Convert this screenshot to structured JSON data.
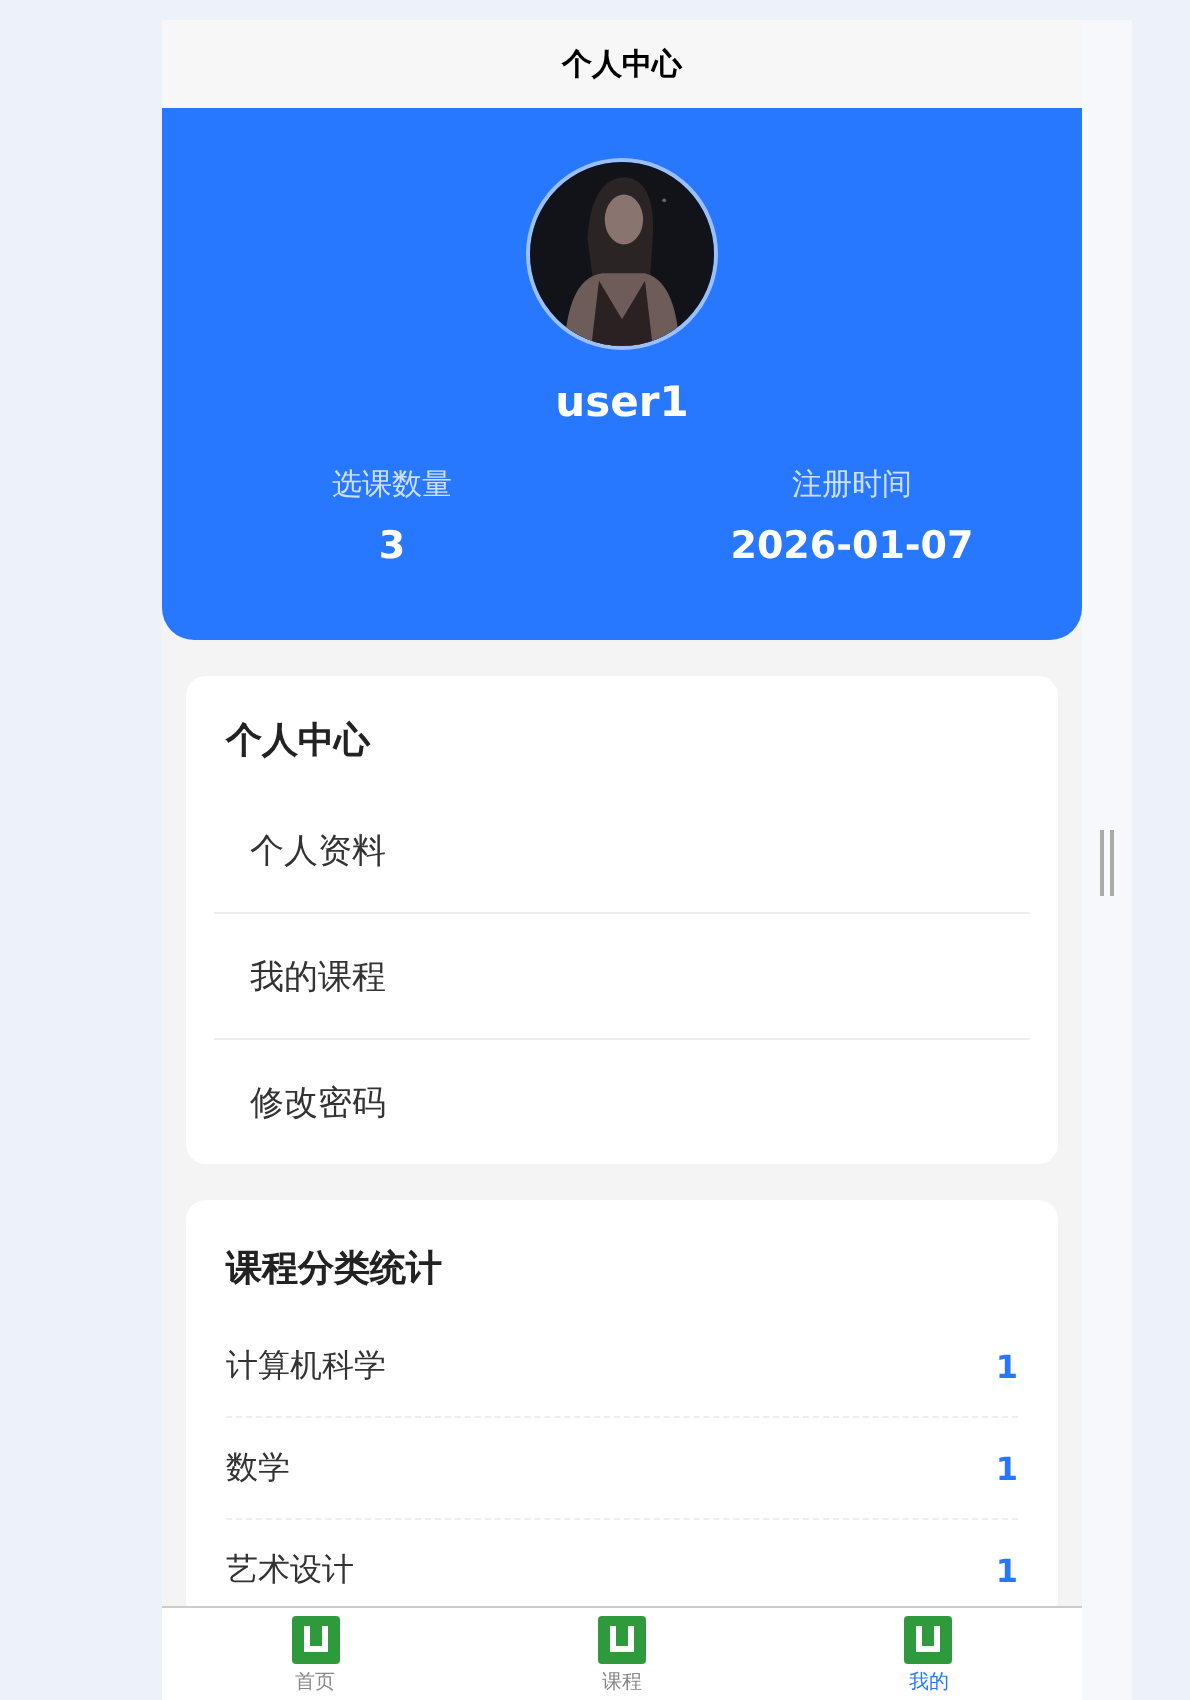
{
  "header": {
    "title": "个人中心"
  },
  "profile": {
    "username": "user1",
    "stats": [
      {
        "label": "选课数量",
        "value": "3"
      },
      {
        "label": "注册时间",
        "value": "2026-01-07"
      }
    ]
  },
  "menu": {
    "title": "个人中心",
    "items": [
      "个人资料",
      "我的课程",
      "修改密码"
    ]
  },
  "category_stats": {
    "title": "课程分类统计",
    "rows": [
      {
        "name": "计算机科学",
        "count": "1"
      },
      {
        "name": "数学",
        "count": "1"
      },
      {
        "name": "艺术设计",
        "count": "1"
      }
    ]
  },
  "tab_bar": [
    {
      "label": "首页",
      "selected": false
    },
    {
      "label": "课程",
      "selected": false
    },
    {
      "label": "我的",
      "selected": true
    }
  ]
}
